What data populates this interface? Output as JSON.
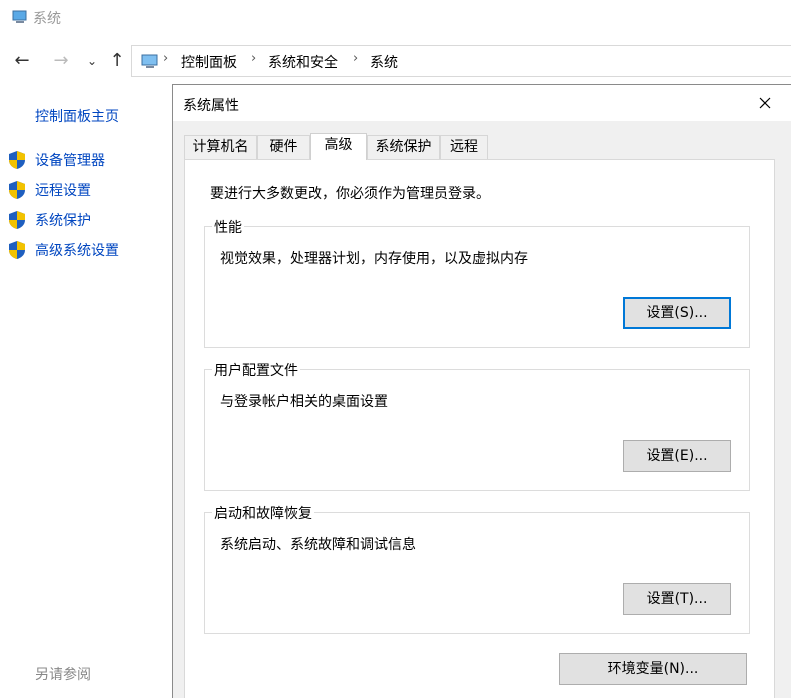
{
  "window": {
    "title": "系统"
  },
  "nav": {
    "back_icon": "back-arrow-icon",
    "forward_icon": "forward-arrow-icon",
    "breadcrumb": [
      "控制面板",
      "系统和安全",
      "系统"
    ]
  },
  "sidebar": {
    "home": "控制面板主页",
    "items": [
      {
        "label": "设备管理器"
      },
      {
        "label": "远程设置"
      },
      {
        "label": "系统保护"
      },
      {
        "label": "高级系统设置"
      }
    ],
    "see_also": "另请参阅"
  },
  "dialog": {
    "title": "系统属性",
    "tabs": [
      "计算机名",
      "硬件",
      "高级",
      "系统保护",
      "远程"
    ],
    "active_tab": "高级",
    "admin_note": "要进行大多数更改，你必须作为管理员登录。",
    "groups": [
      {
        "title": "性能",
        "desc": "视觉效果，处理器计划，内存使用，以及虚拟内存",
        "button": "设置(S)..."
      },
      {
        "title": "用户配置文件",
        "desc": "与登录帐户相关的桌面设置",
        "button": "设置(E)..."
      },
      {
        "title": "启动和故障恢复",
        "desc": "系统启动、系统故障和调试信息",
        "button": "设置(T)..."
      }
    ],
    "env_button": "环境变量(N)..."
  },
  "colors": {
    "link": "#0046c0",
    "focus": "#0078d7",
    "dialog_bg": "#f0f0f0"
  }
}
